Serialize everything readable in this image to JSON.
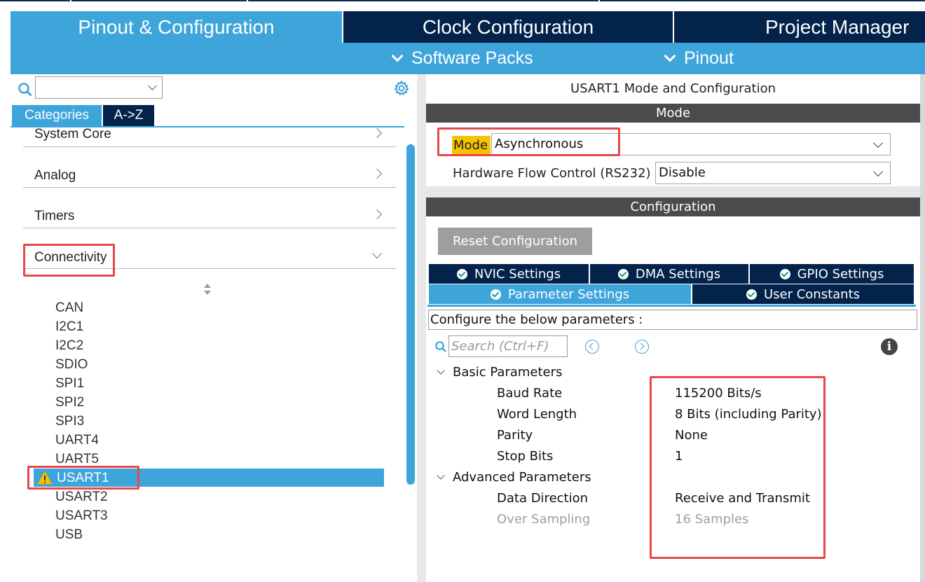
{
  "main_tabs": {
    "pinout": "Pinout & Configuration",
    "clock": "Clock Configuration",
    "project": "Project Manager"
  },
  "sub_menu": {
    "software_packs": "Software Packs",
    "pinout": "Pinout"
  },
  "left_panel": {
    "search_value": "",
    "tabs": {
      "categories": "Categories",
      "az": "A->Z"
    },
    "categories": [
      "System Core",
      "Analog",
      "Timers",
      "Connectivity"
    ],
    "connectivity_items": [
      "CAN",
      "I2C1",
      "I2C2",
      "SDIO",
      "SPI1",
      "SPI2",
      "SPI3",
      "UART4",
      "UART5",
      "USART1",
      "USART2",
      "USART3",
      "USB"
    ],
    "selected_item": "USART1"
  },
  "right_panel": {
    "title": "USART1 Mode and Configuration",
    "mode_section": "Mode",
    "mode_label": "Mode",
    "mode_value": "Asynchronous",
    "hfc_label": "Hardware Flow Control (RS232)",
    "hfc_value": "Disable",
    "config_section": "Configuration",
    "reset_button": "Reset Configuration",
    "tabs": {
      "nvic": "NVIC Settings",
      "dma": "DMA Settings",
      "gpio": "GPIO Settings",
      "parameter": "Parameter Settings",
      "user_constants": "User Constants"
    },
    "configure_text": "Configure the below parameters :",
    "search_placeholder": "Search (Ctrl+F)",
    "info_glyph": "i",
    "basic_group": "Basic Parameters",
    "basic_params": [
      {
        "name": "Baud Rate",
        "value": "115200 Bits/s"
      },
      {
        "name": "Word Length",
        "value": "8 Bits (including Parity)"
      },
      {
        "name": "Parity",
        "value": "None"
      },
      {
        "name": "Stop Bits",
        "value": "1"
      }
    ],
    "advanced_group": "Advanced Parameters",
    "advanced_params": [
      {
        "name": "Data Direction",
        "value": "Receive and Transmit"
      },
      {
        "name": "Over Sampling",
        "value": "16 Samples"
      }
    ]
  },
  "colors": {
    "accent": "#3ea5db",
    "dark": "#03234b",
    "band": "#4b4b4b",
    "highlight": "#f5c400",
    "annotation": "#e8474a",
    "check": "#15a07a"
  },
  "icons": {
    "search": "search-icon",
    "gear": "gear-icon",
    "warning": "warning-icon",
    "info": "info-icon",
    "prev": "prev-icon",
    "next": "next-icon",
    "check": "check-icon",
    "chevron": "chevron-down-icon"
  }
}
